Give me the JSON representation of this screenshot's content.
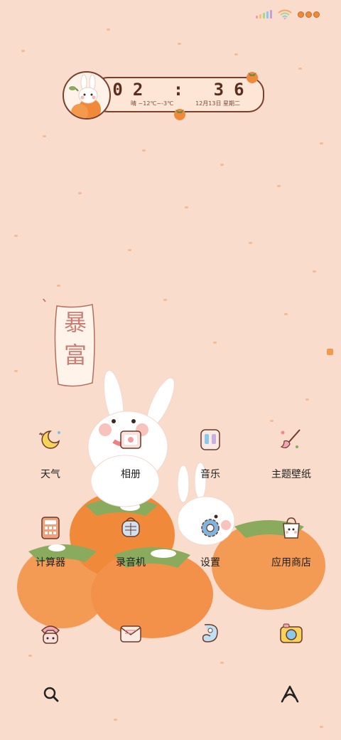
{
  "status_bar": {
    "signal_colors": [
      "#f0a0a0",
      "#f3c27a",
      "#a8d88a",
      "#8cc8e8",
      "#c0a0e0"
    ],
    "wifi_color": "#f3a56a",
    "battery_color": "#f08a3a"
  },
  "clock_widget": {
    "time": "02 : 36",
    "weather": "晴 ~12℃~-3℃",
    "date": "12月13日 星期二"
  },
  "banner": {
    "text": "暴富"
  },
  "apps": [
    {
      "label": "天气",
      "icon": "weather-icon"
    },
    {
      "label": "相册",
      "icon": "gallery-icon"
    },
    {
      "label": "音乐",
      "icon": "music-icon"
    },
    {
      "label": "主题壁纸",
      "icon": "theme-wallpaper-icon"
    },
    {
      "label": "计算器",
      "icon": "calculator-icon"
    },
    {
      "label": "录音机",
      "icon": "recorder-icon"
    },
    {
      "label": "设置",
      "icon": "settings-icon"
    },
    {
      "label": "应用商店",
      "icon": "app-store-icon"
    }
  ],
  "dock": [
    {
      "icon": "phone-icon"
    },
    {
      "icon": "messages-icon"
    },
    {
      "icon": "browser-icon"
    },
    {
      "icon": "camera-icon"
    }
  ],
  "bottom_bar": {
    "left_icon": "search-icon",
    "right_icon": "assistant-icon"
  },
  "colors": {
    "background": "#f9dccb",
    "accent": "#7b3f2c",
    "persimmon": "#f08a3a"
  }
}
